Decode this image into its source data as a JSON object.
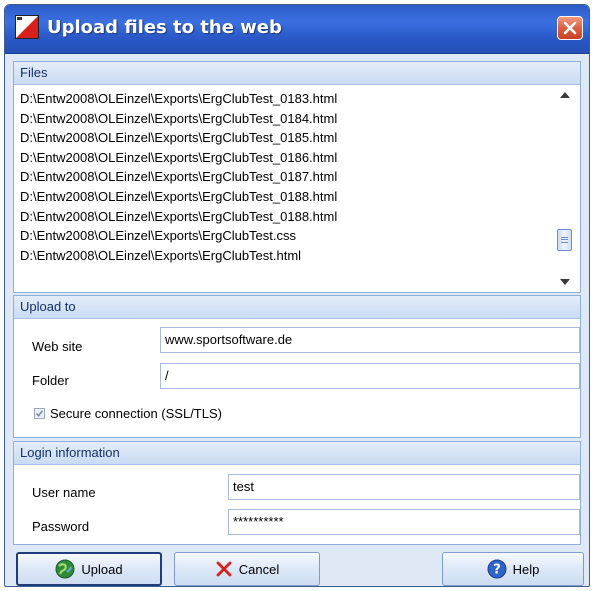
{
  "window": {
    "title": "Upload files to the web"
  },
  "files": {
    "header": "Files",
    "items": [
      "D:\\Entw2008\\OLEinzel\\Exports\\ErgClubTest_0183.html",
      "D:\\Entw2008\\OLEinzel\\Exports\\ErgClubTest_0184.html",
      "D:\\Entw2008\\OLEinzel\\Exports\\ErgClubTest_0185.html",
      "D:\\Entw2008\\OLEinzel\\Exports\\ErgClubTest_0186.html",
      "D:\\Entw2008\\OLEinzel\\Exports\\ErgClubTest_0187.html",
      "D:\\Entw2008\\OLEinzel\\Exports\\ErgClubTest_0188.html",
      "D:\\Entw2008\\OLEinzel\\Exports\\ErgClubTest_0188.html",
      "D:\\Entw2008\\OLEinzel\\Exports\\ErgClubTest.css",
      "D:\\Entw2008\\OLEinzel\\Exports\\ErgClubTest.html"
    ]
  },
  "upload_to": {
    "header": "Upload to",
    "website_label": "Web site",
    "website_value": "www.sportsoftware.de",
    "folder_label": "Folder",
    "folder_value": "/",
    "secure_label": "Secure connection (SSL/TLS)",
    "secure_checked": true
  },
  "login": {
    "header": "Login information",
    "username_label": "User name",
    "username_value": "test",
    "password_label": "Password",
    "password_value": "**********"
  },
  "buttons": {
    "upload": "Upload",
    "cancel": "Cancel",
    "help": "Help"
  },
  "colors": {
    "titlebar": "#2d5cc8",
    "group_border": "#8fb0dc",
    "window_bg": "#dfe9f6"
  }
}
